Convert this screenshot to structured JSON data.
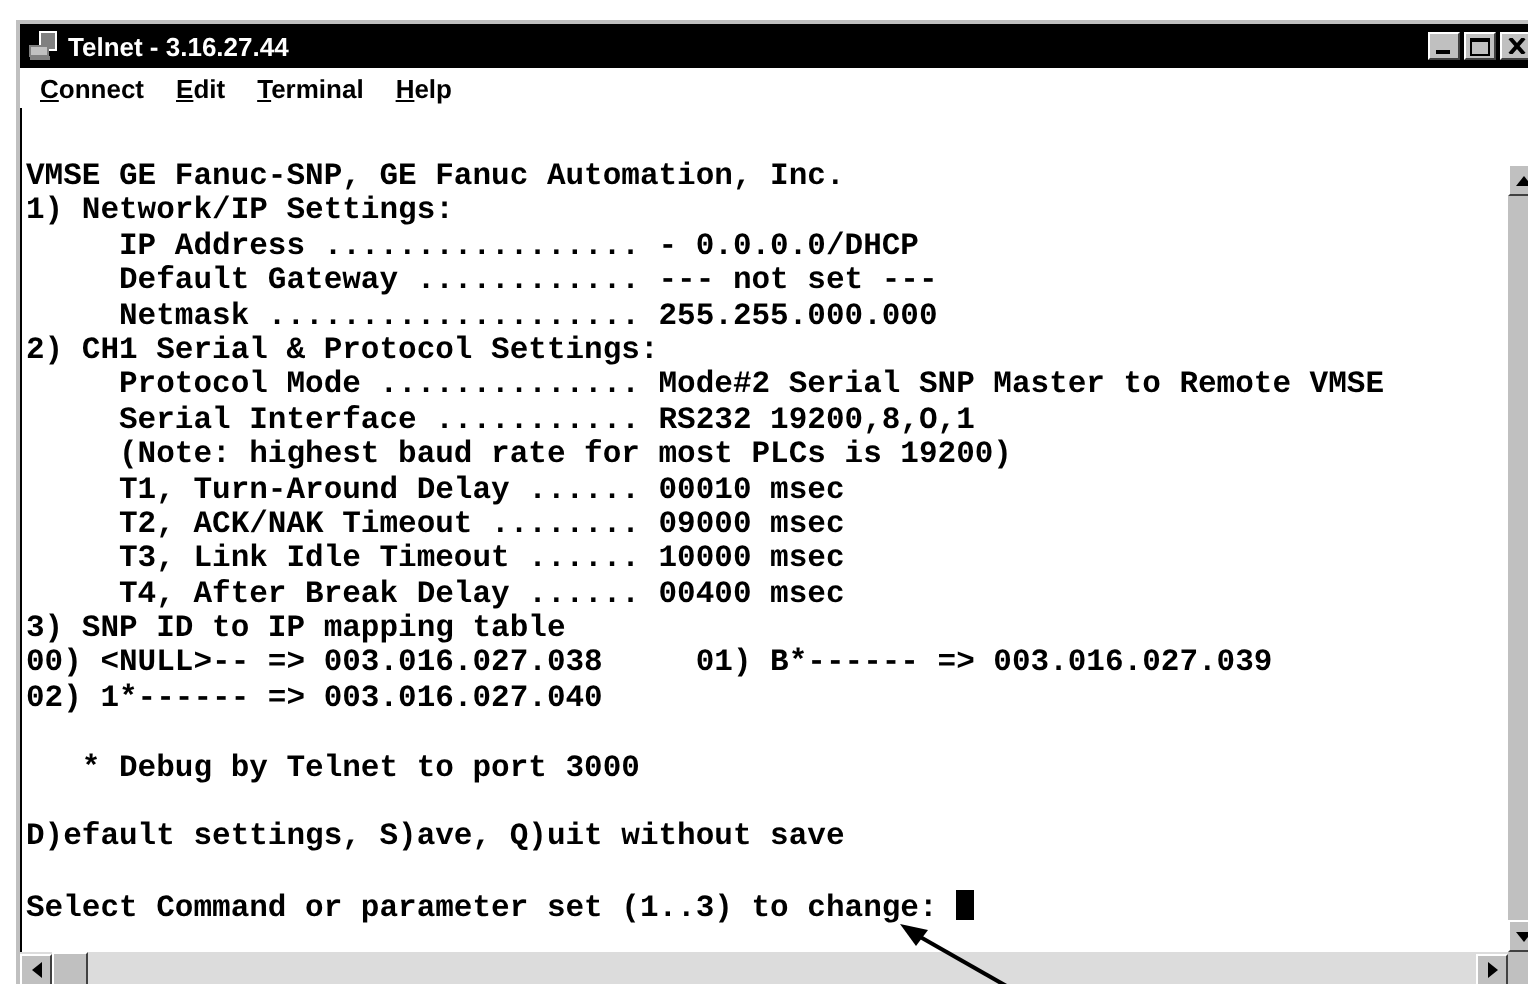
{
  "window": {
    "title": "Telnet - 3.16.27.44"
  },
  "menu": [
    {
      "label": "Connect"
    },
    {
      "label": "Edit"
    },
    {
      "label": "Terminal"
    },
    {
      "label": "Help"
    }
  ],
  "terminal": {
    "blocks": [
      [
        "VMSE GE Fanuc-SNP, GE Fanuc Automation, Inc.",
        "1) Network/IP Settings:",
        "     IP Address ................. - 0.0.0.0/DHCP",
        "     Default Gateway ............ --- not set ---",
        "     Netmask .................... 255.255.000.000",
        "2) CH1 Serial & Protocol Settings:",
        "     Protocol Mode .............. Mode#2 Serial SNP Master to Remote VMSE",
        "     Serial Interface ........... RS232 19200,8,O,1",
        "     (Note: highest baud rate for most PLCs is 19200)",
        "     T1, Turn-Around Delay ...... 00010 msec",
        "     T2, ACK/NAK Timeout ........ 09000 msec",
        "     T3, Link Idle Timeout ...... 10000 msec",
        "     T4, After Break Delay ...... 00400 msec",
        "3) SNP ID to IP mapping table",
        "00) <NULL>-- => 003.016.027.038     01) B*------ => 003.016.027.039",
        "02) 1*------ => 003.016.027.040"
      ],
      [
        "   * Debug by Telnet to port 3000"
      ],
      [
        "D)efault settings, S)ave, Q)uit without save"
      ]
    ],
    "prompt": "Select Command or parameter set (1..3) to change: "
  }
}
